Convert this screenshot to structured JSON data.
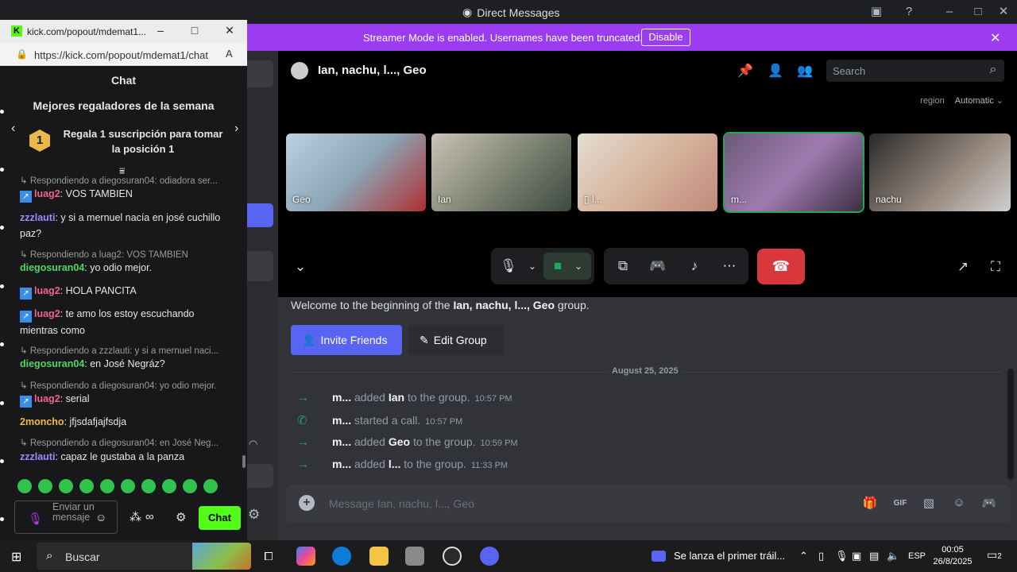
{
  "window": {
    "title": "Direct Messages"
  },
  "streamer_mode": {
    "message": "Streamer Mode is enabled. Usernames have been truncated.",
    "disable_label": "Disable"
  },
  "channel": {
    "name": "Ian, nachu, l..., Geo",
    "search_placeholder": "Search"
  },
  "call": {
    "region_label": "region",
    "region_value": "Automatic",
    "participants": [
      {
        "label": "Geo",
        "active": false
      },
      {
        "label": "Ian",
        "active": false
      },
      {
        "label": "l...",
        "active": false
      },
      {
        "label": "m...",
        "active": true
      },
      {
        "label": "nachu",
        "active": false
      }
    ]
  },
  "welcome": {
    "prefix": "Welcome to the beginning of the ",
    "group": "Ian, nachu, l..., Geo",
    "suffix": " group."
  },
  "buttons": {
    "invite": "Invite Friends",
    "edit": "Edit Group"
  },
  "date_divider": "August 25, 2025",
  "system_messages": [
    {
      "user": "m...",
      "action": "added",
      "target": "Ian",
      "rest": "to the group.",
      "time": "10:57 PM",
      "kind": "join"
    },
    {
      "user": "m...",
      "action": "started a call.",
      "target": "",
      "rest": "",
      "time": "10:57 PM",
      "kind": "call"
    },
    {
      "user": "m...",
      "action": "added",
      "target": "Geo",
      "rest": "to the group.",
      "time": "10:59 PM",
      "kind": "join"
    },
    {
      "user": "m...",
      "action": "added",
      "target": "l...",
      "rest": "to the group.",
      "time": "11:33 PM",
      "kind": "join"
    }
  ],
  "composer": {
    "placeholder": "Message Ian, nachu, l..., Geo"
  },
  "kick": {
    "window_title": "kick.com/popout/mdemat1...",
    "url": "https://kick.com/popout/mdemat1/chat",
    "chat_title": "Chat",
    "top_gifters_title": "Mejores regaladores de la semana",
    "gift_cta": "Regala 1 suscripción para tomar la posición 1",
    "rank": "1",
    "messages": [
      {
        "type": "reply",
        "text": "Respondiendo a diegosuran04: odiadora ser..."
      },
      {
        "type": "msg",
        "user": "luag2",
        "color": "#f06292",
        "badge": true,
        "text": ": VOS TAMBIEN"
      },
      {
        "type": "msg",
        "user": "zzzlauti",
        "color": "#9b8cff",
        "badge": false,
        "text": ": y si a mernuel nacía en josé cuchillo paz?"
      },
      {
        "type": "reply",
        "text": "Respondiendo a luag2: VOS TAMBIEN"
      },
      {
        "type": "msg",
        "user": "diegosuran04",
        "color": "#4cd964",
        "badge": false,
        "text": ": yo odio mejor."
      },
      {
        "type": "msg",
        "user": "luag2",
        "color": "#f06292",
        "badge": true,
        "text": ": HOLA PANCITA"
      },
      {
        "type": "msg",
        "user": "luag2",
        "color": "#f06292",
        "badge": true,
        "text": ": te amo los estoy escuchando mientras como"
      },
      {
        "type": "reply",
        "text": "Respondiendo a zzzlauti: y si a mernuel naci..."
      },
      {
        "type": "msg",
        "user": "diegosuran04",
        "color": "#4cd964",
        "badge": false,
        "text": ": en José Negráz?"
      },
      {
        "type": "reply",
        "text": "Respondiendo a diegosuran04: yo odio mejor."
      },
      {
        "type": "msg",
        "user": "luag2",
        "color": "#f06292",
        "badge": true,
        "text": ": serial"
      },
      {
        "type": "msg",
        "user": "2moncho",
        "color": "#f5b942",
        "badge": false,
        "text": ": jfjsdafjajfsdja"
      },
      {
        "type": "reply",
        "text": "Respondiendo a diegosuran04: en José Neg..."
      },
      {
        "type": "msg",
        "user": "zzzlauti",
        "color": "#9b8cff",
        "badge": false,
        "text": ": capaz le gustaba a la panza"
      }
    ],
    "input_placeholder": "Enviar un mensaje",
    "chat_button": "Chat"
  },
  "taskbar": {
    "search_label": "Buscar",
    "news": "Se lanza el primer tráil...",
    "language": "ESP",
    "time": "00:05",
    "date": "26/8/2025",
    "notifications": "2"
  }
}
